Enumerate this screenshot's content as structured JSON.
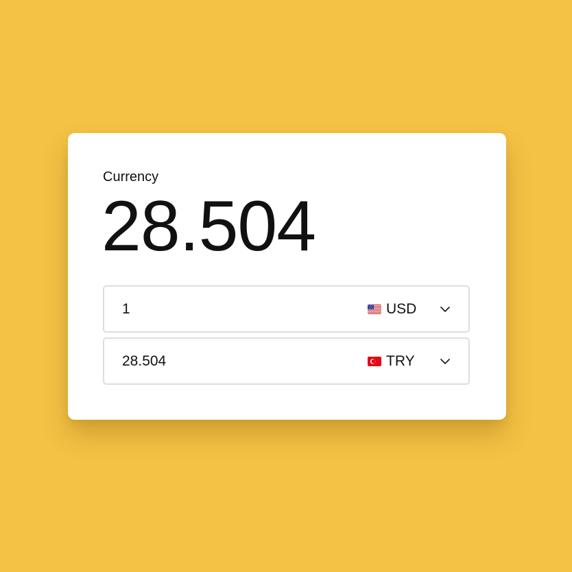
{
  "widget": {
    "label": "Currency",
    "result": "28.504"
  },
  "rows": [
    {
      "amount": "1",
      "currency_code": "USD",
      "flag_icon": "us-flag-icon"
    },
    {
      "amount": "28.504",
      "currency_code": "TRY",
      "flag_icon": "turkey-flag-icon"
    }
  ],
  "colors": {
    "background": "#F4C244",
    "card": "#FFFFFF",
    "border": "#DEDEDE",
    "text": "#111111"
  }
}
